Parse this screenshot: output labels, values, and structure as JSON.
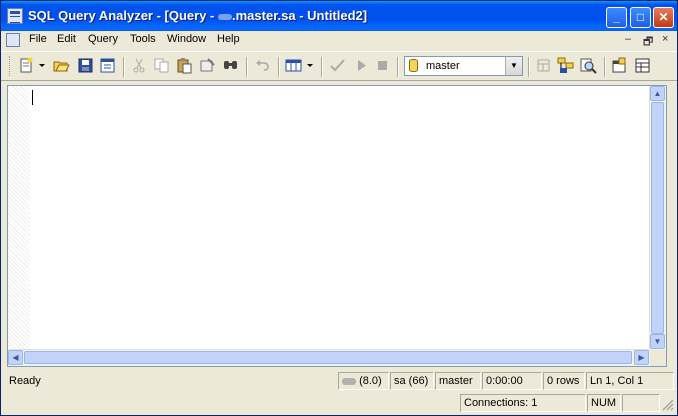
{
  "window": {
    "title_prefix": "SQL Query Analyzer - [Query - ",
    "title_suffix": ".master.sa - Untitled2]",
    "controls": {
      "minimize": "_",
      "maximize": "□",
      "close": "✕"
    }
  },
  "menubar": {
    "items": [
      "File",
      "Edit",
      "Query",
      "Tools",
      "Window",
      "Help"
    ],
    "mdi_controls": [
      "–",
      "🗗",
      "×"
    ]
  },
  "toolbar": {
    "database": "master",
    "icons": [
      "new-query-icon",
      "dropdown-arrow-icon",
      "open-icon",
      "save-icon",
      "load-script-icon",
      "cut-icon",
      "copy-icon",
      "paste-icon",
      "clear-window-icon",
      "find-icon",
      "undo-icon",
      "results-mode-icon",
      "dropdown-arrow-icon",
      "parse-icon",
      "execute-icon",
      "cancel-icon",
      "display-plan-icon",
      "object-browser-icon",
      "object-search-icon",
      "connection-properties-icon",
      "show-results-pane-icon"
    ]
  },
  "editor": {
    "content": ""
  },
  "status": {
    "ready": "Ready",
    "server_version": "(8.0)",
    "user": "sa (66)",
    "database": "master",
    "elapsed": "0:00:00",
    "rows": "0 rows",
    "position": "Ln 1, Col 1",
    "connections": "Connections: 1",
    "num": "NUM"
  }
}
